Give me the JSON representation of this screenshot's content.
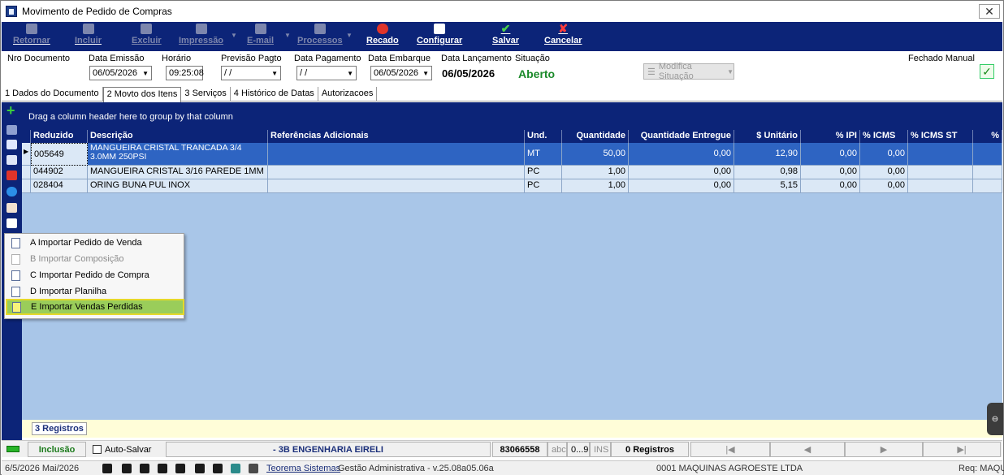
{
  "window": {
    "title": "Movimento de Pedido de Compras",
    "close_symbol": "✕"
  },
  "toolbar": {
    "retornar": "Retornar",
    "incluir": "Incluir",
    "excluir": "Excluir",
    "impressao": "Impressão",
    "email": "E-mail",
    "processos": "Processos",
    "recado": "Recado",
    "configurar": "Configurar",
    "salvar": "Salvar",
    "cancelar": "Cancelar"
  },
  "fields": {
    "nro_documento_label": "Nro Documento",
    "data_emissao_label": "Data Emissão",
    "data_emissao": "06/05/2026",
    "horario_label": "Horário",
    "horario": "09:25:08",
    "previsao_pagto_label": "Previsão Pagto",
    "previsao_pagto": " / /",
    "data_pagamento_label": "Data Pagamento",
    "data_pagamento": " / /",
    "data_embarque_label": "Data Embarque",
    "data_embarque": "06/05/2026",
    "data_lancamento_label": "Data Lançamento",
    "data_lancamento": "06/05/2026",
    "situacao_label": "Situação",
    "situacao": "Aberto",
    "modifica_situacao": "Modifica Situação",
    "fechado_manual_label": "Fechado Manual"
  },
  "tabs": [
    "1 Dados do Documento",
    "2 Movto dos Itens",
    "3 Serviços",
    "4 Histórico de Datas",
    "Autorizacoes"
  ],
  "grid": {
    "group_hint": "Drag a column header here to group by that column",
    "columns": [
      "Reduzido",
      "Descrição",
      "Referências Adicionais",
      "Und.",
      "Quantidade",
      "Quantidade Entregue",
      "$ Unitário",
      "% IPI",
      "% ICMS",
      "% ICMS ST",
      "%"
    ],
    "rows": [
      {
        "reduzido": "005649",
        "descricao": "MANGUEIRA CRISTAL TRANCADA 3/4 3.0MM 250PSI",
        "referencias": "",
        "und": "MT",
        "quantidade": "50,00",
        "qtd_entregue": "0,00",
        "unitario": "12,90",
        "ipi": "0,00",
        "icms": "0,00",
        "icms_st": "",
        "pct": ""
      },
      {
        "reduzido": "044902",
        "descricao": "MANGUEIRA CRISTAL 3/16 PAREDE 1MM",
        "referencias": "",
        "und": "PC",
        "quantidade": "1,00",
        "qtd_entregue": "0,00",
        "unitario": "0,98",
        "ipi": "0,00",
        "icms": "0,00",
        "icms_st": "",
        "pct": ""
      },
      {
        "reduzido": "028404",
        "descricao": "ORING BUNA PUL INOX",
        "referencias": "",
        "und": "PC",
        "quantidade": "1,00",
        "qtd_entregue": "0,00",
        "unitario": "5,15",
        "ipi": "0,00",
        "icms": "0,00",
        "icms_st": "",
        "pct": ""
      }
    ],
    "record_count": "3 Registros"
  },
  "popup_menu": [
    "A Importar Pedido de Venda",
    "B Importar Composição",
    "C Importar Pedido de Compra",
    "D Importar Planilha",
    "E Importar Vendas Perdidas"
  ],
  "status": {
    "mode": "Inclusão",
    "auto_salvar": "Auto-Salvar",
    "company": "- 3B ENGENHARIA EIRELI",
    "code": "83066558",
    "abc": "abc",
    "digits": "0...9",
    "ins": "INS",
    "registros": "0 Registros",
    "nav_first": "|◀",
    "nav_prev": "◀",
    "nav_next": "▶",
    "nav_last": "▶|"
  },
  "bottom": {
    "date": "6/5/2026 Mai/2026",
    "teorema": "Teorema Sistemas",
    "version": "Gestão Administrativa - v.25.08a05.06a",
    "empresa": "0001 MAQUINAS AGROESTE LTDA",
    "req": "Req: MAQU"
  }
}
